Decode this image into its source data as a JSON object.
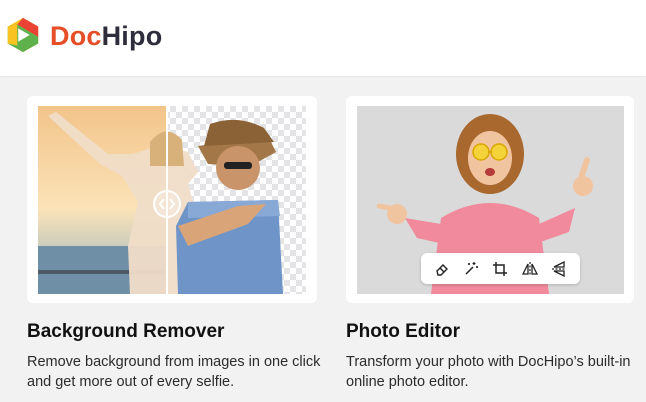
{
  "brand": {
    "name_part1": "Doc",
    "name_part2": "Hipo",
    "colors": {
      "orange": "#e54e26",
      "dark": "#2d2d3c",
      "green": "#4caf50",
      "yellow": "#f9c322",
      "red": "#ea4335"
    }
  },
  "features": [
    {
      "title": "Background Remover",
      "description": "Remove background from images in one click and get more out of every selfie."
    },
    {
      "title": "Photo Editor",
      "description": "Transform your photo with DocHipo’s built-in online photo editor."
    }
  ],
  "editor_toolbar": {
    "tools": [
      "eraser-icon",
      "magic-wand-icon",
      "crop-icon",
      "flip-horizontal-icon",
      "flip-vertical-icon"
    ]
  }
}
